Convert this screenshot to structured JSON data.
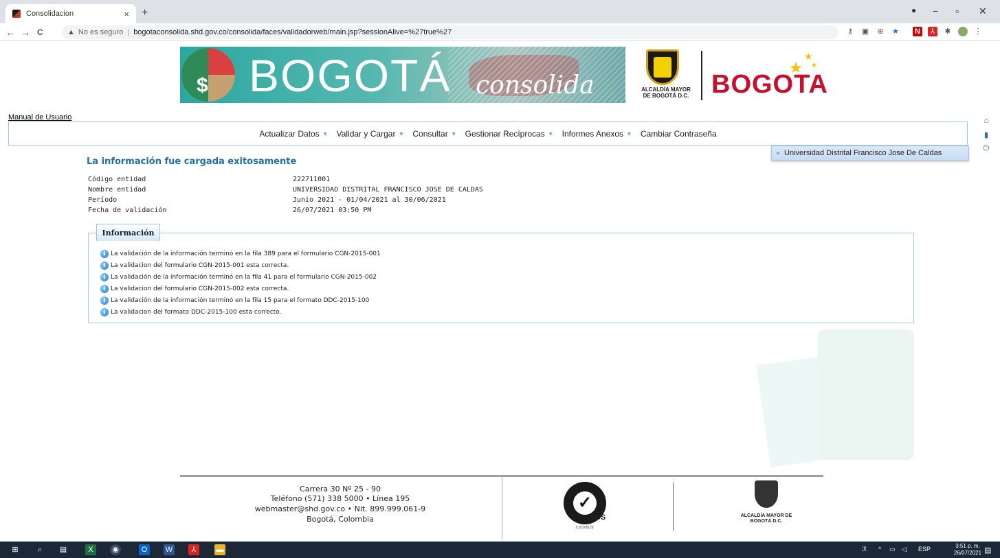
{
  "browser": {
    "tab_title": "Consolidacion",
    "tab_close": "×",
    "new_tab": "+",
    "minimize": "−",
    "maximize": "▫",
    "close": "✕",
    "back": "←",
    "forward": "→",
    "reload": "C",
    "security": "No es seguro",
    "url": "bogotaconsolida.shd.gov.co/consolida/faces/validadorweb/main.jsp?sessionAlive=%27true%27"
  },
  "banner": {
    "title": "BOGOTÁ",
    "subtitle": "consolida",
    "alcaldia": "ALCALDÍA MAYOR DE BOGOTÁ D.C.",
    "bogota_logo": "BOGOTA"
  },
  "manual_link": "Manual de Usuario",
  "menu": [
    {
      "label": "Actualizar Datos",
      "has_dropdown": true
    },
    {
      "label": "Validar y Cargar",
      "has_dropdown": true
    },
    {
      "label": "Consultar",
      "has_dropdown": true
    },
    {
      "label": "Gestionar Recíprocas",
      "has_dropdown": true
    },
    {
      "label": "Informes Anexos",
      "has_dropdown": true
    },
    {
      "label": "Cambiar Contraseña",
      "has_dropdown": false
    }
  ],
  "user": {
    "name": "Universidad Distrital Francisco Jose De Caldas"
  },
  "result": {
    "title": "La información fue cargada exitosamente",
    "fields": [
      {
        "label": "Código entidad",
        "value": "222711001"
      },
      {
        "label": "Nombre entidad",
        "value": "UNIVERSIDAD DISTRITAL FRANCISCO JOSE DE CALDAS"
      },
      {
        "label": "Período",
        "value": "Junio 2021 - 01/04/2021 al 30/06/2021"
      },
      {
        "label": "Fecha de validación",
        "value": "26/07/2021 03:50 PM"
      }
    ]
  },
  "info": {
    "tab": "Información",
    "messages": [
      "La validación de la información terminó en la fila 389 para el formulario CGN-2015-001",
      "La validacion del formulario CGN-2015-001 esta correcta.",
      "La validación de la información terminó en la fila 41 para el formulario CGN-2015-002",
      "La validacion del formulario CGN-2015-002 esta correcta.",
      "La validación de la información terminó en la fila 15 para el formato DDC-2015-100",
      "La validacion del formato DDC-2015-100 esta correcto."
    ]
  },
  "footer": {
    "address": "Carrera 30 Nº 25 - 90",
    "phone": "Teléfono (571) 338 5000 • Línea 195",
    "email": "webmaster@shd.gov.co • Nit. 899.999.061-9",
    "city": "Bogotá, Colombia",
    "sgs": "SGS",
    "sgs_code": "CO18/8129",
    "alcaldia": "ALCALDÍA MAYOR DE BOGOTÁ D.C."
  },
  "taskbar": {
    "lang": "ESP",
    "time": "3:51 p. m.",
    "date": "26/07/2021"
  }
}
